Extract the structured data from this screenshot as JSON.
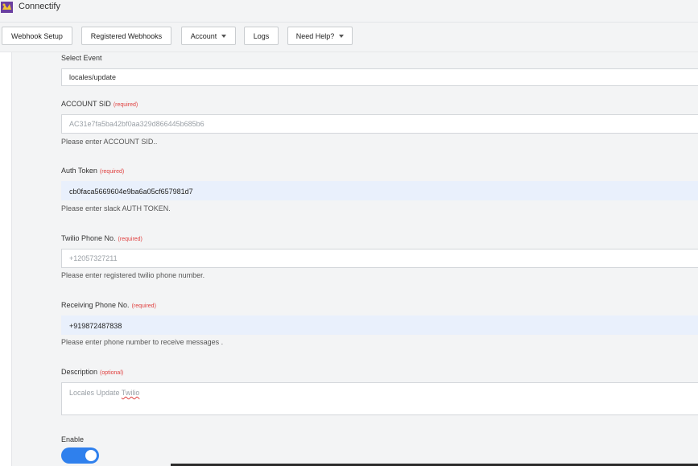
{
  "app": {
    "title": "Connectify"
  },
  "toolbar": {
    "webhook_setup": "Webhook Setup",
    "registered_webhooks": "Registered Webhooks",
    "account": "Account",
    "logs": "Logs",
    "need_help": "Need Help?"
  },
  "form": {
    "select_event": {
      "label": "Select Event",
      "value": "locales/update"
    },
    "account_sid": {
      "label": "ACCOUNT SID",
      "tag": "(required)",
      "placeholder": "AC31e7fa5ba42bf0aa329d866445b685b6",
      "help": "Please enter ACCOUNT SID.."
    },
    "auth_token": {
      "label": "Auth Token",
      "tag": "(required)",
      "value": "cb0faca5669604e9ba6a05cf657981d7",
      "help": "Please enter slack AUTH TOKEN."
    },
    "twilio_phone": {
      "label": "Twilio Phone No.",
      "tag": "(required)",
      "placeholder": "+12057327211",
      "help": "Please enter registered twilio phone number."
    },
    "receiving_phone": {
      "label": "Receiving Phone No.",
      "tag": "(required)",
      "value": "+919872487838",
      "help": "Please enter phone number to receive messages ."
    },
    "description": {
      "label": "Description",
      "tag": "(optional)",
      "placeholder_main": "Locales Update ",
      "placeholder_word": "Twilio"
    },
    "enable": {
      "label": "Enable",
      "on": true
    }
  },
  "colors": {
    "accent": "#2f80ed",
    "required": "#e0403f",
    "filled_bg": "#e9f0fc"
  }
}
